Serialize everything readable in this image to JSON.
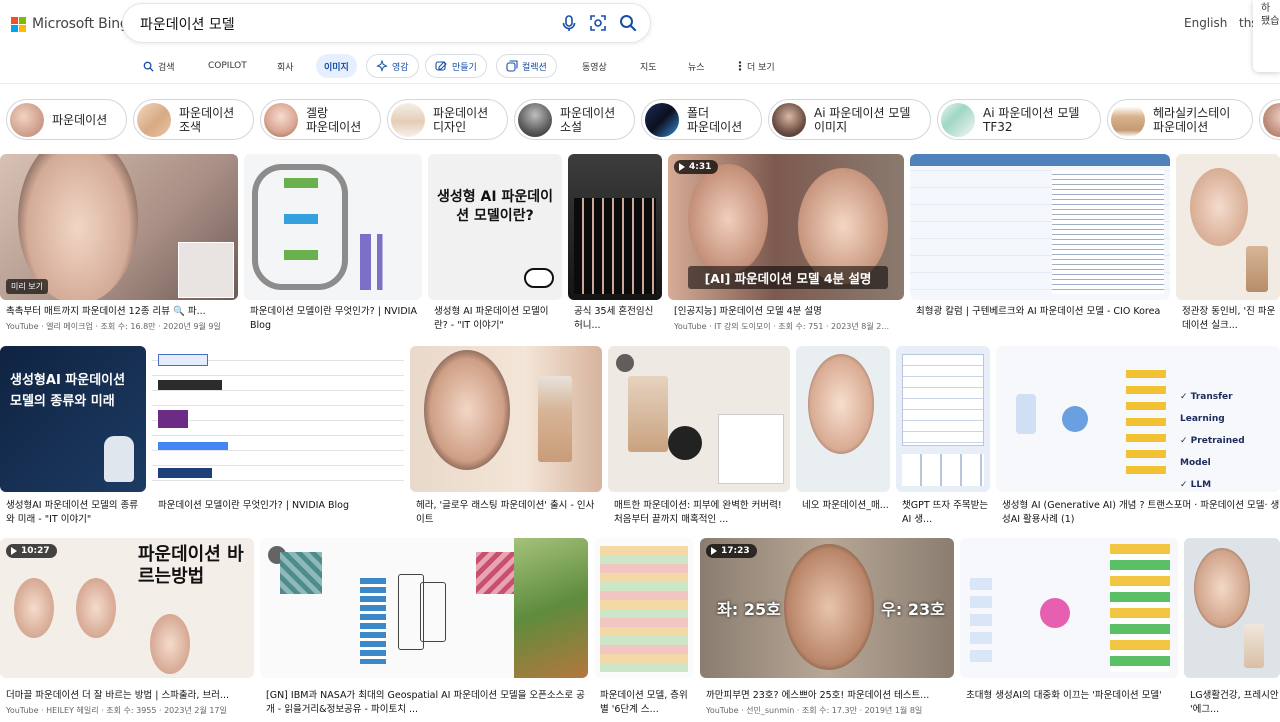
{
  "app": {
    "brand": "Microsoft Bing"
  },
  "search": {
    "query": "파운데이션 모델"
  },
  "header": {
    "language": "English",
    "cut_text": "ths",
    "corner_card_text": "하\n됐습"
  },
  "tabs": [
    {
      "label": "검색",
      "icon": "search-icon"
    },
    {
      "label": "COPILOT"
    },
    {
      "label": "회사"
    },
    {
      "label": "이미지",
      "active": true
    },
    {
      "label": "영감",
      "icon": "sparkle-icon"
    },
    {
      "label": "만들기",
      "icon": "create-icon"
    },
    {
      "label": "컬렉션",
      "icon": "collection-icon"
    },
    {
      "label": "동영상"
    },
    {
      "label": "지도"
    },
    {
      "label": "뉴스"
    },
    {
      "label": "더 보기",
      "icon": "more-icon"
    }
  ],
  "chips": [
    {
      "line1": "파운데이션",
      "line2": ""
    },
    {
      "line1": "파운데이션",
      "line2": "조색"
    },
    {
      "line1": "겔랑",
      "line2": "파운데이션"
    },
    {
      "line1": "파운데이션",
      "line2": "디자인"
    },
    {
      "line1": "파운데이션",
      "line2": "소설"
    },
    {
      "line1": "폴더",
      "line2": "파운데이션"
    },
    {
      "line1": "Ai 파운데이션 모델",
      "line2": "이미지"
    },
    {
      "line1": "Ai 파운데이션 모델",
      "line2": "TF32"
    },
    {
      "line1": "헤라실키스테이",
      "line2": "파운데이션"
    }
  ],
  "results": [
    {
      "caption": "촉촉부터 매트까지 파운데이션 12종 리뷰 🔍 파...",
      "meta": "YouTube · 엘리 메이크업 · 조회 수: 16.8만 · 2020년 9월 9일",
      "overlay": "미리 보기"
    },
    {
      "caption": "파운데이션 모델이란 무엇인가? | NVIDIA Blog",
      "meta": ""
    },
    {
      "caption": "생성형 AI 파운데이션 모델이란? - \"IT 이야기\"",
      "meta": "",
      "overlay": "생성형 AI 파운데이션 모델이란?"
    },
    {
      "caption": "공식 35세 혼전임신 허니...",
      "meta": ""
    },
    {
      "caption": "[인공지능] 파운데이션 모델 4분 설명",
      "meta": "YouTube · IT 강의 도이모이 · 조회 수: 751 · 2023년 8월 2...",
      "duration": "4:31",
      "overlay": "[AI] 파운데이션 모델 4분 설명"
    },
    {
      "caption": "최형광 칼럼 | 구텐베르크와 AI 파운데이션 모델 - CIO Korea",
      "meta": ""
    },
    {
      "caption": "정관장 동인비, '진 파운데이션 실크...",
      "meta": ""
    },
    {
      "caption": "생성형AI 파운데이션 모델의 종류와 미래 - \"IT 이야기\"",
      "meta": "",
      "overlay": "생성형AI 파운데이션 모델의 종류와 미래"
    },
    {
      "caption": "파운데이션 모델이란 무엇인가? | NVIDIA Blog",
      "meta": ""
    },
    {
      "caption": "헤라, '글로우 래스팅 파운데이션' 출시 - 인사이트",
      "meta": ""
    },
    {
      "caption": "매트한 파운데이션: 피부에 완벽한 커버력! 처음부터 끝까지 매혹적인 ...",
      "meta": ""
    },
    {
      "caption": "네오 파운데이션_매...",
      "meta": ""
    },
    {
      "caption": "챗GPT 뜨자 주목받는 AI 생...",
      "meta": ""
    },
    {
      "caption": "생성형 AI (Generative AI) 개념 ? 트랜스포머 · 파운데이션 모델· 생성AI 활용사례 (1)",
      "meta": ""
    },
    {
      "caption": "더마끌 파운데이션 더 잘 바르는 방법 | 스파출라, 브러...",
      "meta": "YouTube · HEILEY 헤일리 · 조회 수: 3955 · 2023년 2월 17일",
      "duration": "10:27",
      "overlay": "파운데이션 바르는방법"
    },
    {
      "caption": "[GN] IBM과 NASA가 최대의 Geospatial AI 파운데이션 모델을 오픈소스로 공개 - 읽을거리&정보공유 - 파이토치 ...",
      "meta": ""
    },
    {
      "caption": "파운데이션 모델, 층위별 '6단계 스...",
      "meta": ""
    },
    {
      "caption": "까만피부면 23호? 에스쁘아 25호! 파운데이션 테스트...",
      "meta": "YouTube · 선민_sunmin · 조회 수: 17.3만 · 2019년 1월 8일",
      "duration": "17:23",
      "overlay_left": "좌: 25호",
      "overlay_right": "우: 23호"
    },
    {
      "caption": "초대형 생성AI의 대중화 이끄는 '파운데이션 모델'",
      "meta": ""
    },
    {
      "caption": "LG생활건강, 프레시안 '에그...",
      "meta": ""
    }
  ],
  "colors": {
    "accent": "#174ea6",
    "active_tab_bg": "#e6efff",
    "logo_red": "#f25022",
    "logo_green": "#7fba00",
    "logo_blue": "#00a4ef",
    "logo_yellow": "#ffb900"
  }
}
